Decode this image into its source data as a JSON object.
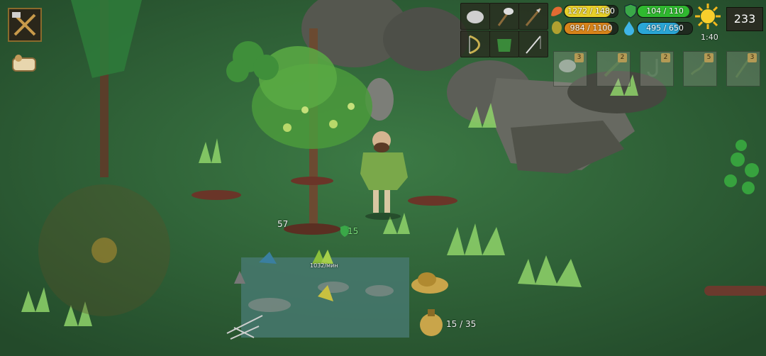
{
  "hud": {
    "health": {
      "text": "1272 / 1480",
      "ratio": 0.86,
      "color": "#e8d02a"
    },
    "defense": {
      "text": "104 / 110",
      "ratio": 0.945,
      "color": "#2fb92f"
    },
    "hunger": {
      "text": "984 / 1100",
      "ratio": 0.895,
      "color": "#d8841a"
    },
    "thirst": {
      "text": "495 / 650",
      "ratio": 0.76,
      "color": "#2aa6d6"
    },
    "time": "1:40",
    "day_counter": "233"
  },
  "equipment_slots": [
    "stone-icon",
    "stone-axe-icon",
    "stone-spear-icon",
    "bow-icon",
    "leaf-armor-icon",
    "fishing-rod-icon"
  ],
  "quick_slots": [
    {
      "icon": "stone-icon",
      "count": "3"
    },
    {
      "icon": "stick-icon",
      "count": "2"
    },
    {
      "icon": "hook-icon",
      "count": "2"
    },
    {
      "icon": "rope-icon",
      "count": "5"
    },
    {
      "icon": "fishing-pole-icon",
      "count": "3"
    }
  ],
  "world": {
    "tree_label": "57",
    "armor_label": "15",
    "pond_label": "1032/мин",
    "water_capacity": "15 / 35"
  },
  "colors": {
    "grass": "#2f5a35",
    "pond": "#3f6d66",
    "rock": "#5b5d56"
  }
}
